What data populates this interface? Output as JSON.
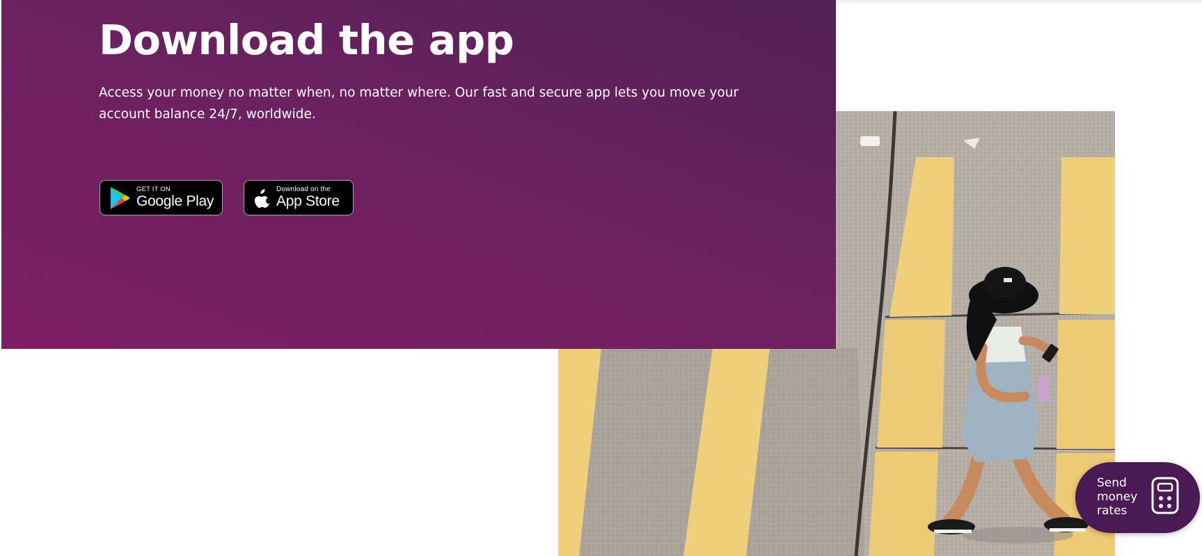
{
  "hero": {
    "title": "Download the app",
    "description": "Access your money no matter when, no matter where. Our fast and secure app lets you move your account balance 24/7, worldwide."
  },
  "store_badges": {
    "google_play": {
      "small": "GET IT ON",
      "big": "Google Play",
      "icon": "google-play-icon"
    },
    "app_store": {
      "small": "Download on the",
      "big": "App Store",
      "icon": "apple-icon"
    }
  },
  "rates_widget": {
    "label": "Send money rates",
    "icon": "calculator-icon"
  },
  "colors": {
    "hero_gradient_start": "#512155",
    "hero_gradient_end": "#7d1f62",
    "widget_background": "#4a1a55",
    "badge_background": "#000000",
    "crosswalk_yellow": "#efcf7a",
    "asphalt": "#b4ada6"
  },
  "photo": {
    "description_icon": "street-photo-image"
  }
}
